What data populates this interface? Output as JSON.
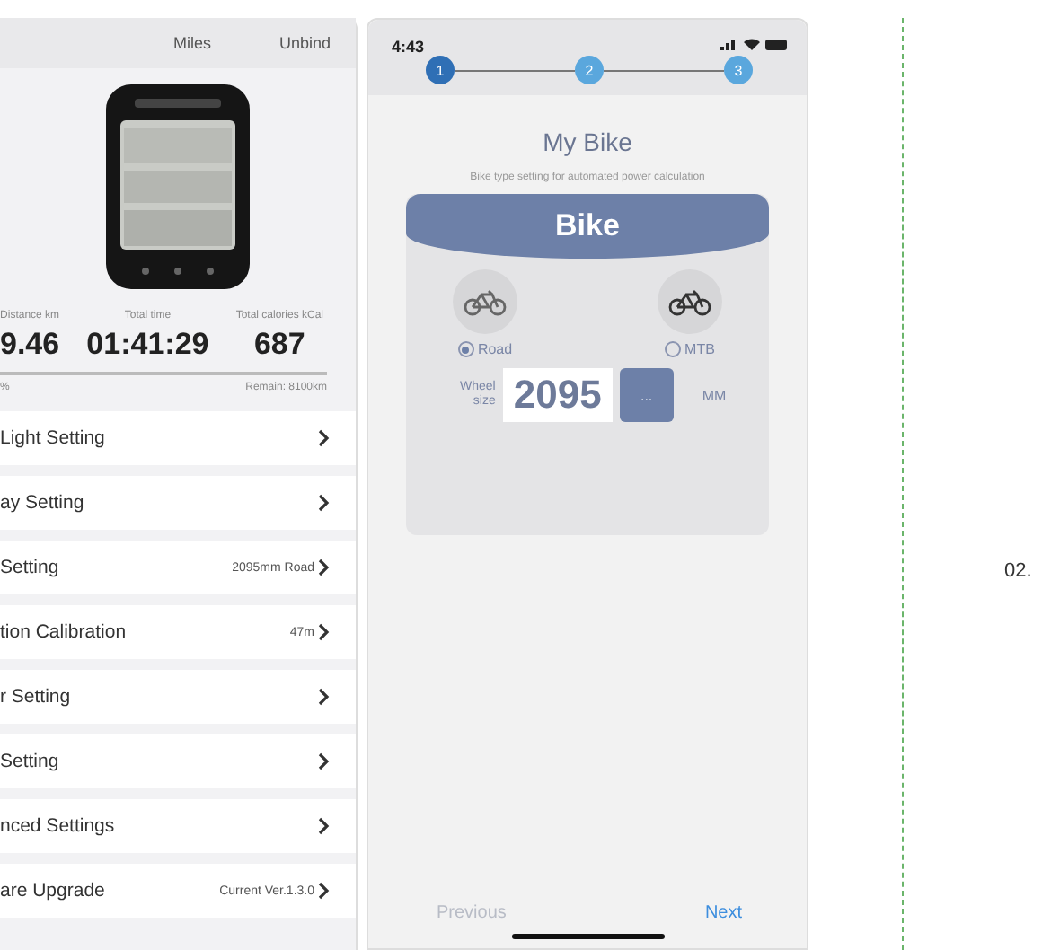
{
  "left_screen": {
    "header": {
      "unit": "Miles",
      "unbind": "Unbind"
    },
    "stats": [
      {
        "label": "Distance km",
        "value": "9.46"
      },
      {
        "label": "Total time",
        "value": "01:41:29"
      },
      {
        "label": "Total calories kCal",
        "value": "687"
      }
    ],
    "usage": {
      "percent": "%",
      "remain": "Remain: 8100km"
    },
    "settings": [
      {
        "label": "Light Setting"
      },
      {
        "label": "ay Setting"
      },
      {
        "label": "Setting",
        "value": "2095mm Road"
      },
      {
        "label": "tion Calibration",
        "value": "47m"
      },
      {
        "label": "r Setting"
      },
      {
        "label": "Setting"
      },
      {
        "label": "nced Settings"
      },
      {
        "label": "are Upgrade",
        "value": "Current Ver.1.3.0"
      }
    ]
  },
  "right_screen": {
    "status_time": "4:43",
    "steps": [
      {
        "label": "1",
        "selected": true
      },
      {
        "label": "2",
        "selected": false
      },
      {
        "label": "3",
        "selected": false
      }
    ],
    "title": "My Bike",
    "subtitle": "Bike type setting for automated power calculation",
    "card_title": "Bike",
    "bike_types": [
      {
        "label": "Road",
        "selected": true
      },
      {
        "label": "MTB",
        "selected": false
      }
    ],
    "wheel": {
      "label": "Wheel size",
      "value": "2095",
      "button": "...",
      "unit": "MM"
    },
    "nav": [
      {
        "label": "Previous",
        "disabled": true
      },
      {
        "label": "Next",
        "disabled": false
      }
    ]
  },
  "side_label": "02."
}
